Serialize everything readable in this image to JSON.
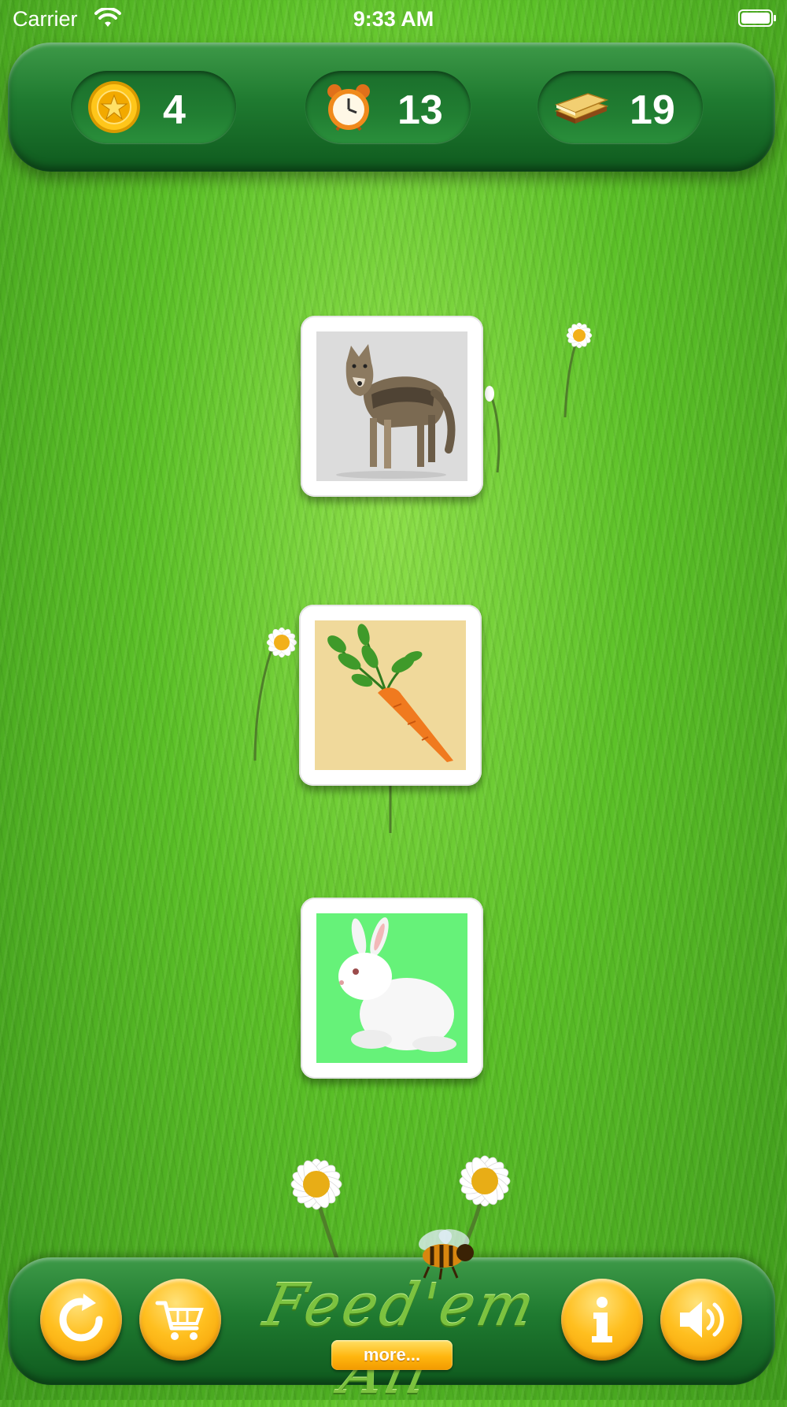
{
  "status_bar": {
    "carrier": "Carrier",
    "time": "9:33 AM"
  },
  "counters": [
    {
      "icon": "coin-icon",
      "value": "4"
    },
    {
      "icon": "alarm-clock-icon",
      "value": "13"
    },
    {
      "icon": "cookie-stack-icon",
      "value": "19"
    }
  ],
  "cards": [
    {
      "icon": "wolf-image",
      "background": "#dcdcdc"
    },
    {
      "icon": "carrot-image",
      "background": "#f0d99b"
    },
    {
      "icon": "rabbit-image",
      "background": "#66f279"
    }
  ],
  "toolbar": {
    "title": "Feed'em All",
    "more_label": "more...",
    "buttons": [
      "restart-icon",
      "cart-icon",
      "info-icon",
      "sound-icon"
    ]
  },
  "colors": {
    "panel_green": "#1f7a30",
    "button_orange": "#ffbf1f",
    "grass": "#5cc128"
  }
}
